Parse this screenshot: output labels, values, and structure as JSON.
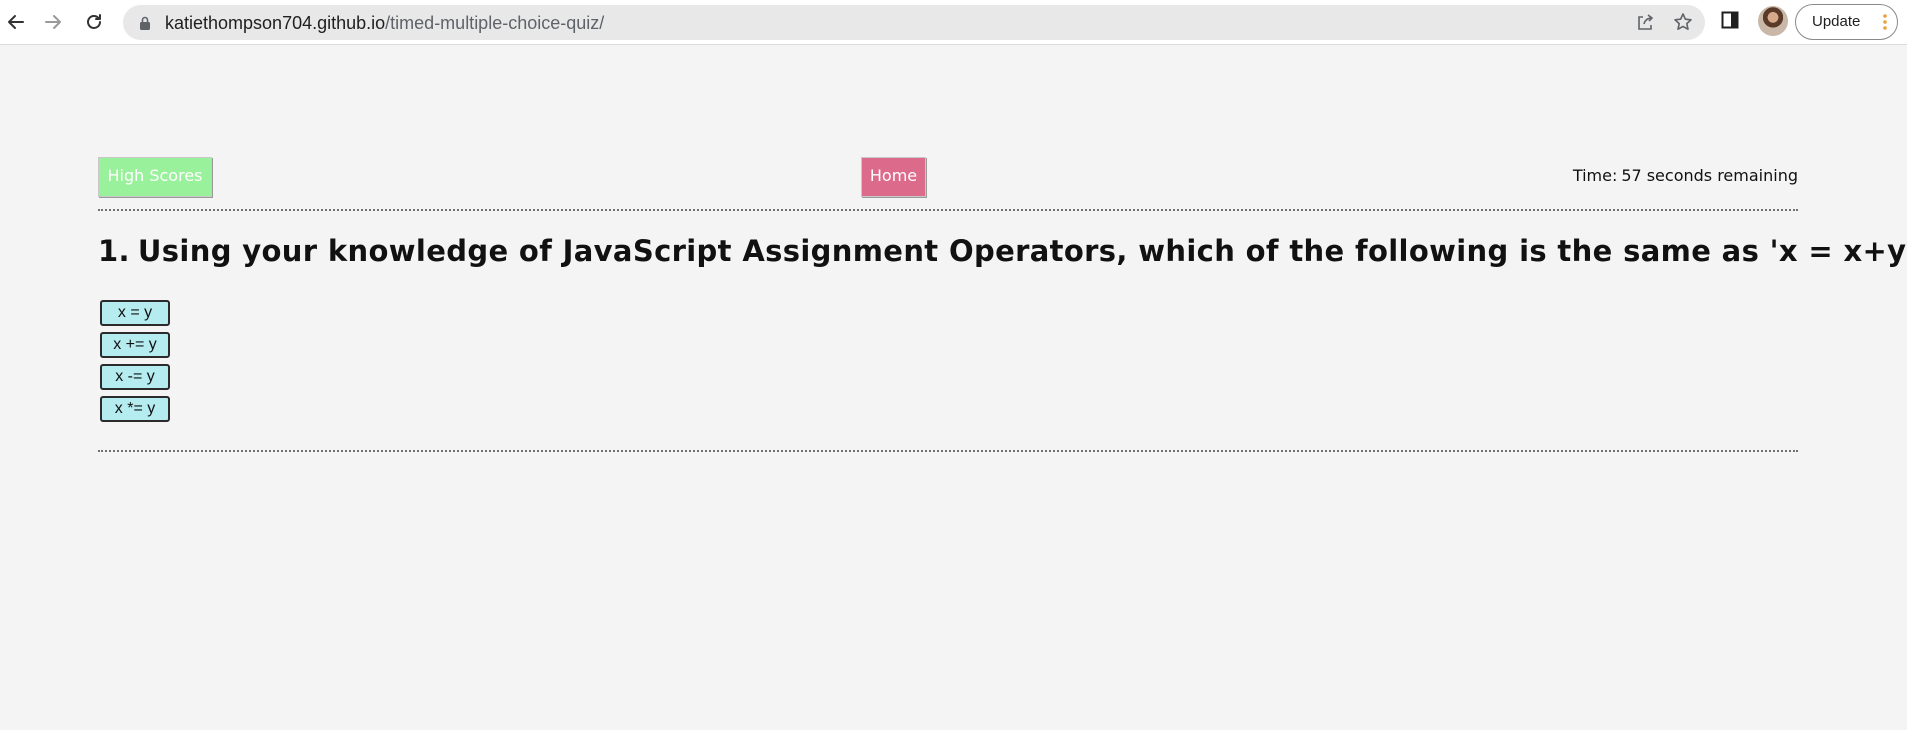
{
  "browser": {
    "url_host": "katiethompson704.github.io",
    "url_path": "/timed-multiple-choice-quiz/",
    "update_label": "Update",
    "icons": {
      "back": "back-arrow-icon",
      "forward": "forward-arrow-icon",
      "reload": "reload-icon",
      "lock": "lock-icon",
      "share": "share-icon",
      "bookmark": "star-icon",
      "side_panel": "side-panel-icon",
      "menu": "kebab-menu-icon"
    }
  },
  "header": {
    "high_scores_label": "High Scores",
    "home_label": "Home",
    "timer_prefix": "Time:",
    "timer_seconds": "57",
    "timer_suffix": "seconds remaining"
  },
  "question": {
    "number": "1.",
    "text": "Using your knowledge of JavaScript Assignment Operators, which of the following is the same as 'x = x+y' ?"
  },
  "answers": [
    {
      "label": "x = y"
    },
    {
      "label": "x += y"
    },
    {
      "label": "x -= y"
    },
    {
      "label": "x *= y"
    }
  ],
  "colors": {
    "high_scores_button": "#99f29b",
    "home_button": "#dc6b8b",
    "answer_button": "#b4ecef",
    "page_background": "#f4f4f4",
    "update_menu_dots": "#e9a23b"
  }
}
